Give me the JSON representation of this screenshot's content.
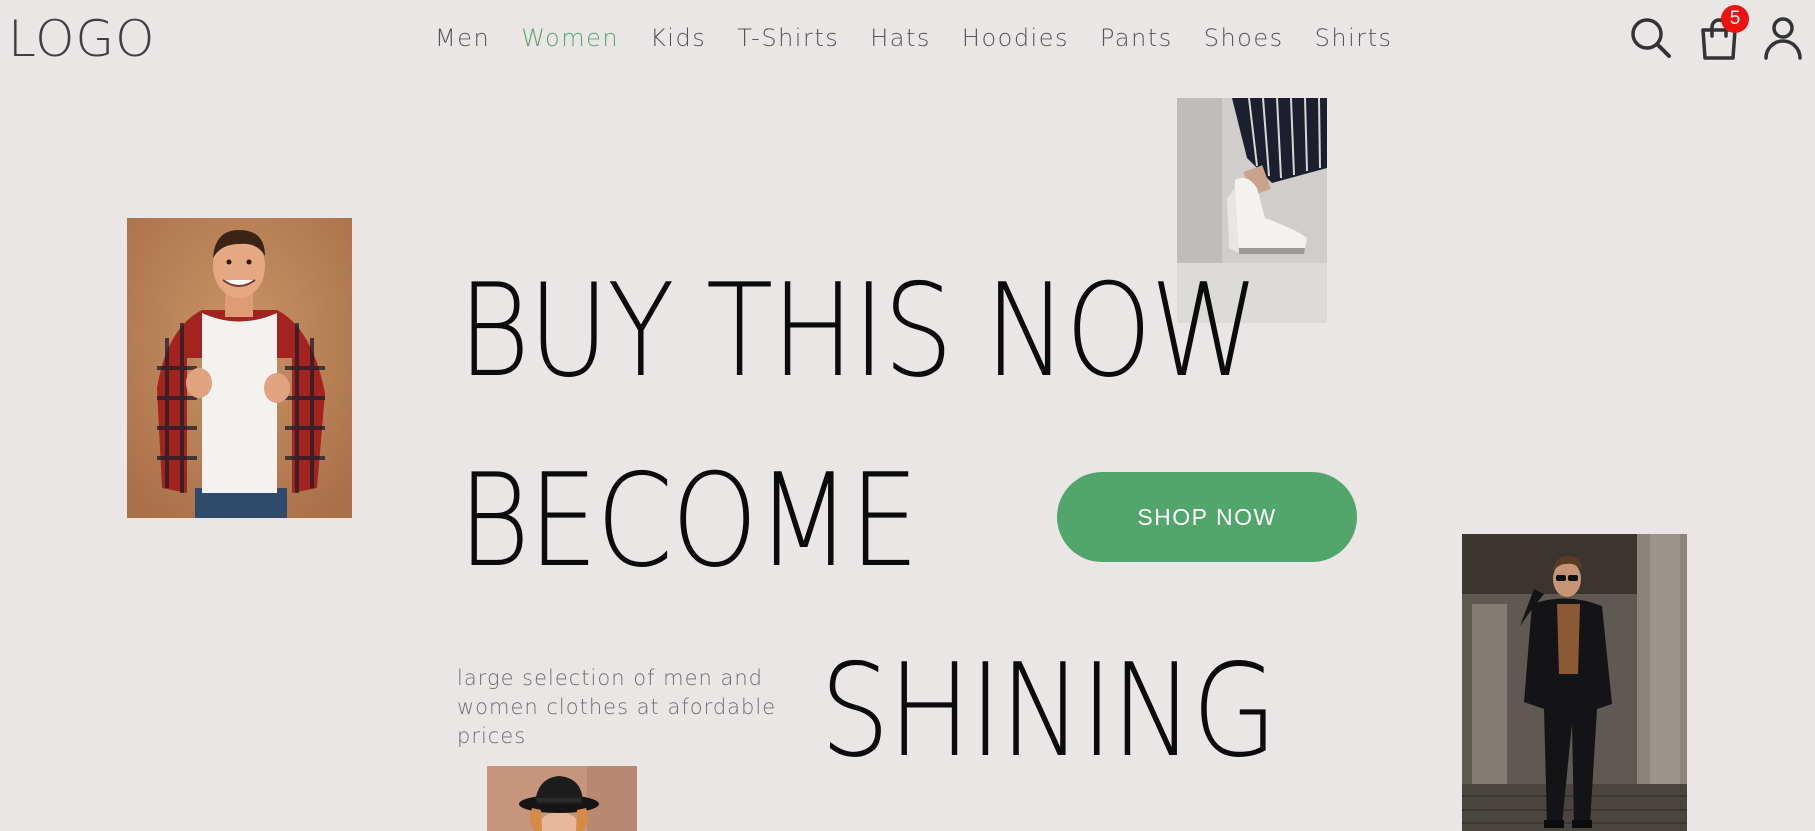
{
  "header": {
    "logo": "LOGO",
    "nav": [
      {
        "label": "Men"
      },
      {
        "label": "Women"
      },
      {
        "label": "Kids"
      },
      {
        "label": "T-Shirts"
      },
      {
        "label": "Hats"
      },
      {
        "label": "Hoodies"
      },
      {
        "label": "Pants"
      },
      {
        "label": "Shoes"
      },
      {
        "label": "Shirts"
      }
    ],
    "active_nav": "Women",
    "cart_count": "5",
    "icons": [
      "search-icon",
      "cart-icon",
      "user-icon"
    ]
  },
  "hero": {
    "line1": "BUY THIS NOW",
    "line2": "BECOME",
    "line3": "SHINING",
    "cta": "SHOP NOW",
    "tagline": "large selection of men and women clothes at afordable prices"
  },
  "colors": {
    "background": "#e9e6e5",
    "accent": "#53a66b",
    "badge": "#ee1111"
  }
}
